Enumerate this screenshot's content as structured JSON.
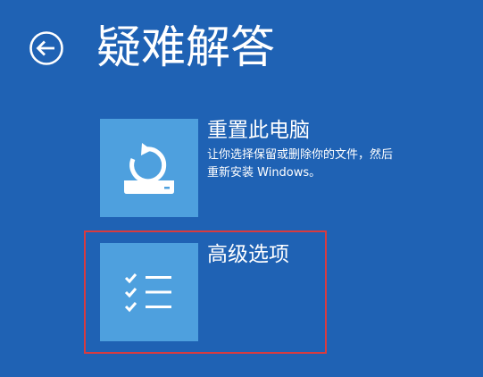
{
  "page": {
    "title": "疑难解答"
  },
  "back_button": {
    "icon": "arrow-left-icon"
  },
  "options": [
    {
      "title": "重置此电脑",
      "description_lines": [
        "让你选择保留或删除你的文件，然后",
        "重新安装 Windows。"
      ],
      "icon": "reset-pc-icon"
    },
    {
      "title": "高级选项",
      "icon": "checklist-icon"
    }
  ],
  "colors": {
    "background": "#1f62b4",
    "tile": "#4ea0de",
    "highlight": "#d93b3f",
    "text": "#ffffff"
  }
}
